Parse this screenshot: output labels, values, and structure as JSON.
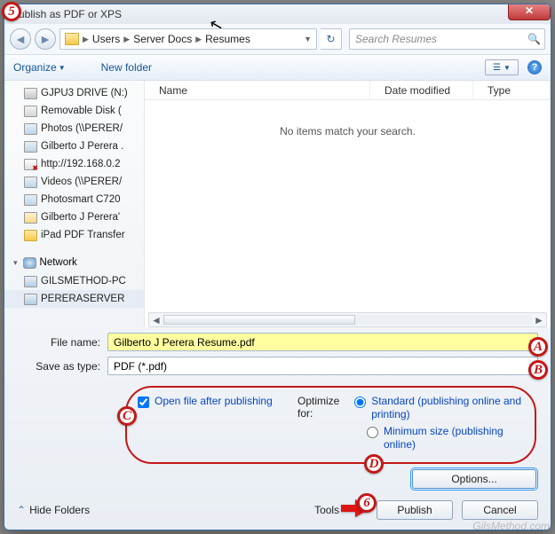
{
  "window": {
    "title": "Publish as PDF or XPS"
  },
  "breadcrumb": {
    "seg1": "Users",
    "seg2": "Server Docs",
    "seg3": "Resumes"
  },
  "search": {
    "placeholder": "Search Resumes"
  },
  "toolbar": {
    "organize": "Organize",
    "newfolder": "New folder"
  },
  "sidebar": {
    "items": [
      "GJPU3 DRIVE (N:)",
      "Removable Disk (",
      "Photos (\\\\PERER/",
      "Gilberto J Perera .",
      "http://192.168.0.2",
      "Videos (\\\\PERER/",
      "Photosmart C720",
      "Gilberto J Perera'",
      "iPad PDF Transfer"
    ],
    "network_label": "Network",
    "net_items": [
      "GILSMETHOD-PC",
      "PERERASERVER"
    ]
  },
  "columns": {
    "name": "Name",
    "date": "Date modified",
    "type": "Type"
  },
  "filelist": {
    "empty": "No items match your search."
  },
  "fields": {
    "filename_label": "File name:",
    "filename_value": "Gilberto J Perera Resume.pdf",
    "savetype_label": "Save as type:",
    "savetype_value": "PDF (*.pdf)"
  },
  "options": {
    "open_after": "Open file after publishing",
    "optimize_label": "Optimize for:",
    "standard": "Standard (publishing online and printing)",
    "minimum": "Minimum size (publishing online)",
    "options_btn": "Options..."
  },
  "footer": {
    "hide_folders": "Hide Folders",
    "tools": "Tools",
    "publish": "Publish",
    "cancel": "Cancel"
  },
  "callouts": {
    "c5": "5",
    "cA": "A",
    "cB": "B",
    "cC": "C",
    "cD": "D",
    "c6": "6"
  },
  "watermark": "GilsMethod.com"
}
